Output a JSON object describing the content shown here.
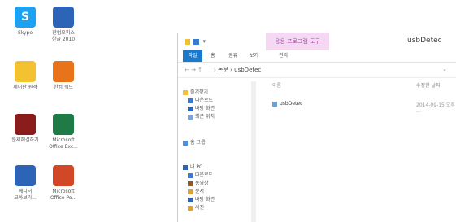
{
  "desktop": {
    "icons": [
      {
        "label": "Skype",
        "icon": "skype-icon"
      },
      {
        "label": "한컴오피스\n한글 2010",
        "icon": "hwp-icon"
      },
      {
        "label": "제어판 원격",
        "icon": "control-panel-icon"
      },
      {
        "label": "한컴 워드",
        "icon": "hancom-word-icon"
      },
      {
        "label": "문제해결하기",
        "icon": "book-icon"
      },
      {
        "label": "Microsoft\nOffice Exc...",
        "icon": "excel-icon"
      },
      {
        "label": "에디터\n모아보기...",
        "icon": "tool-icon"
      },
      {
        "label": "Microsoft\nOffice Po...",
        "icon": "powerpoint-icon"
      }
    ]
  },
  "window": {
    "title": "usbDetec",
    "tool_context": "응용 프로그램 도구",
    "ribbon_tabs": [
      "파일",
      "홈",
      "공유",
      "보기",
      "관리"
    ],
    "address": "› 논문 › usbDetec",
    "nav_items": [
      "즐겨찾기",
      "다운로드",
      "바탕 화면",
      "최근 위치",
      "홈 그룹",
      "내 PC",
      "다운로드",
      "동영상",
      "문서",
      "바탕 화면",
      "사진"
    ],
    "columns": {
      "name": "이름",
      "date": "수정한 날짜"
    },
    "files": [
      {
        "name": "usbDetec",
        "date": "2014-09-15 오후 ..."
      }
    ]
  },
  "colors": {
    "file_tab": "#1979ca",
    "tool_context_bg": "#f5d9f2"
  }
}
